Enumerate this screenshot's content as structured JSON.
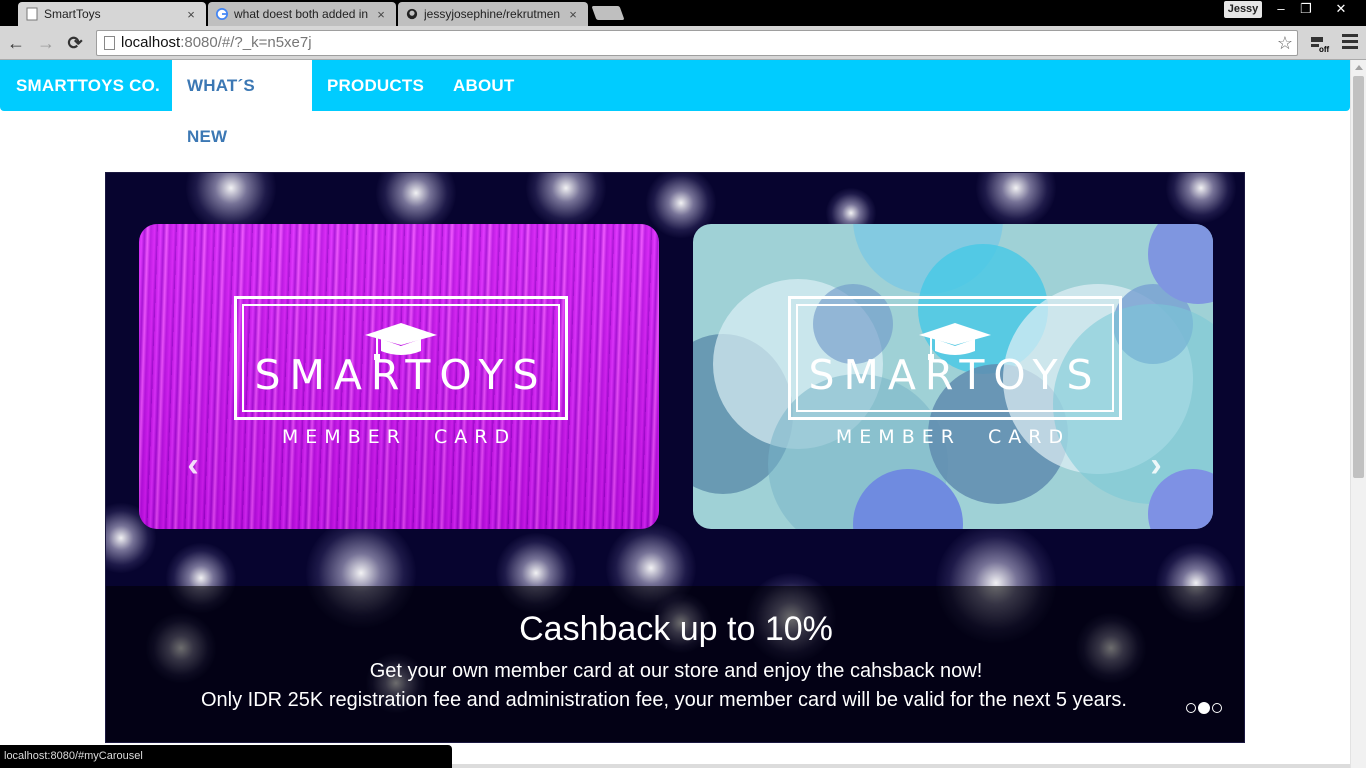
{
  "browser": {
    "tabs": [
      {
        "title": "SmartToys",
        "close": "×"
      },
      {
        "title": "what doest both added in",
        "close": "×"
      },
      {
        "title": "jessyjosephine/rekrutmen",
        "close": "×"
      }
    ],
    "profile_name": "Jessy",
    "window_controls": {
      "minimize": "–",
      "restore": "❐",
      "close": "✕"
    },
    "nav": {
      "back": "←",
      "forward": "→",
      "reload": "⟳"
    },
    "address": {
      "host": "localhost",
      "path": ":8080/#/?_k=n5xe7j"
    },
    "bookmark_star": "☆",
    "extension_label": "off",
    "status_url": "localhost:8080/#myCarousel"
  },
  "navbar": {
    "brand": "SMARTTOYS CO.",
    "items": [
      {
        "label": "WHAT´S NEW",
        "active": true
      },
      {
        "label": "PRODUCTS",
        "active": false
      },
      {
        "label": "ABOUT",
        "active": false
      }
    ]
  },
  "carousel": {
    "cards": [
      {
        "logo": "SMARTOYS",
        "subtitle": "MEMBER CARD",
        "style": "purple"
      },
      {
        "logo": "SMARTOYS",
        "subtitle": "MEMBER CARD",
        "style": "blue-bubbles"
      }
    ],
    "prev_icon": "‹",
    "next_icon": "›",
    "caption": {
      "title": "Cashback up to 10%",
      "line1": "Get your own member card at our store and enjoy the cahsback now!",
      "line2": "Only IDR 25K registration fee and administration fee, your member card will be valid for the next 5 years."
    },
    "indicators": {
      "count": 3,
      "active_index": 1
    },
    "colors": {
      "background": "#07042f",
      "navbar": "#00ccff",
      "active_nav_text": "#3c78b4"
    }
  }
}
